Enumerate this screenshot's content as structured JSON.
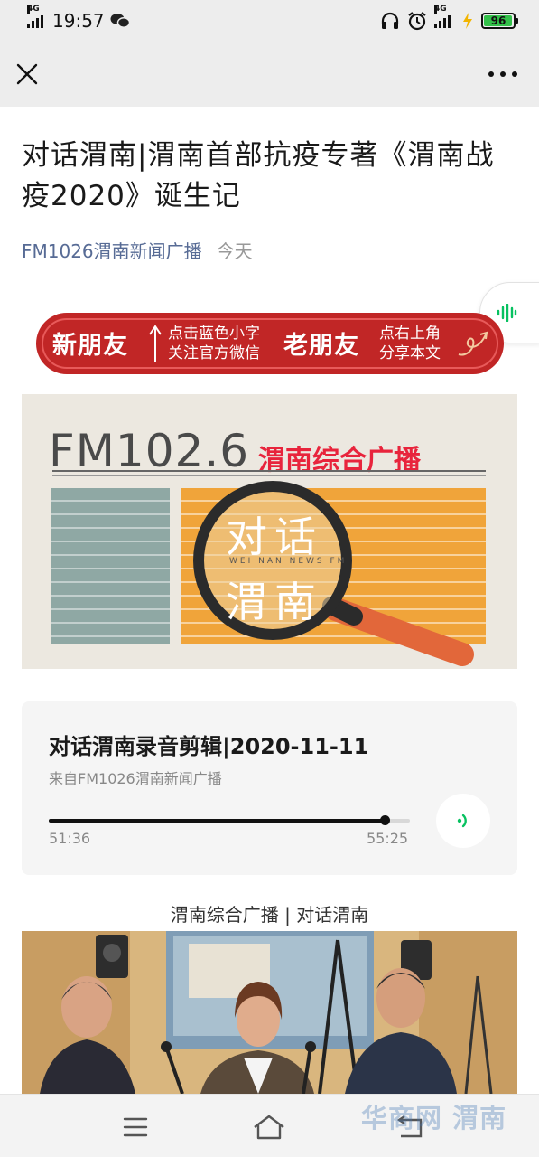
{
  "status_bar": {
    "network": "4G",
    "time": "19:57",
    "battery": "96"
  },
  "article": {
    "title": "对话渭南|渭南首部抗疫专著《渭南战疫2020》诞生记",
    "account": "FM1026渭南新闻广播",
    "date": "今天"
  },
  "banner": {
    "new_friend": "新朋友",
    "new_hint_line1": "点击蓝色小字",
    "new_hint_line2": "关注官方微信",
    "old_friend": "老朋友",
    "old_hint_line1": "点右上角",
    "old_hint_line2": "分享本文"
  },
  "cover": {
    "frequency": "FM102.6",
    "station": "渭南综合广播",
    "show_line1": "对话",
    "show_line2": "渭南",
    "show_subtitle": "WEI NAN NEWS FM"
  },
  "audio": {
    "title": "对话渭南录音剪辑|2020-11-11",
    "source": "来自FM1026渭南新闻广播",
    "current_time": "51:36",
    "total_time": "55:25",
    "progress": 0.93
  },
  "caption": "渭南综合广播 | 对话渭南",
  "watermark": "华商网 渭南",
  "colors": {
    "link": "#576b95",
    "banner_red": "#c12626",
    "accent_green": "#07c160",
    "cover_orange": "#f0a43a",
    "cover_teal": "#8fa8a4"
  },
  "icons": [
    "close-icon",
    "more-icon",
    "audio-wave-icon",
    "play-icon",
    "menu-icon",
    "home-icon",
    "back-icon",
    "headphones-icon",
    "alarm-icon",
    "charging-icon",
    "wechat-icon"
  ]
}
